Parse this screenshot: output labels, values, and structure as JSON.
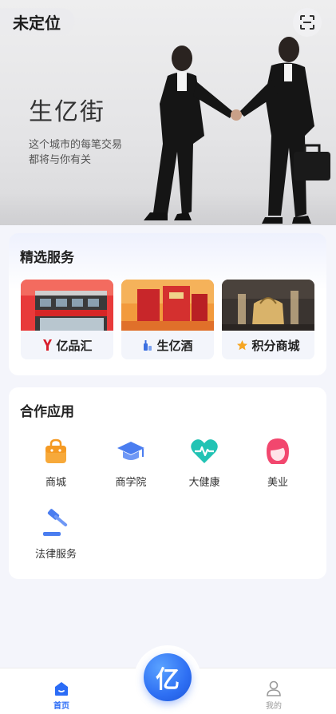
{
  "hero": {
    "location": "未定位",
    "title": "生亿街",
    "subtitle_line1": "这个城市的每笔交易",
    "subtitle_line2": "都将与你有关",
    "scan_icon": "scan-icon"
  },
  "services": {
    "title": "精选服务",
    "items": [
      {
        "label": "亿品汇",
        "icon": "yipinhui-logo-icon",
        "image": "storefront-photo"
      },
      {
        "label": "生亿酒",
        "icon": "liquor-bottle-icon",
        "image": "liquor-gift-box-photo"
      },
      {
        "label": "积分商城",
        "icon": "star-icon",
        "image": "luxury-goods-photo"
      }
    ]
  },
  "apps": {
    "title": "合作应用",
    "items": [
      {
        "label": "商城",
        "icon": "shopping-bag-icon",
        "color": "#f59a23"
      },
      {
        "label": "商学院",
        "icon": "graduation-cap-icon",
        "color": "#4a7df0"
      },
      {
        "label": "大健康",
        "icon": "heart-pulse-icon",
        "color": "#22c3b4"
      },
      {
        "label": "美业",
        "icon": "woman-avatar-icon",
        "color": "#f2476e"
      },
      {
        "label": "法律服务",
        "icon": "gavel-icon",
        "color": "#4a7df0"
      }
    ]
  },
  "tabbar": {
    "home": "首页",
    "center": "亿",
    "mine": "我的"
  },
  "colors": {
    "accent": "#2b6cf6",
    "background": "#f4f5fb"
  }
}
